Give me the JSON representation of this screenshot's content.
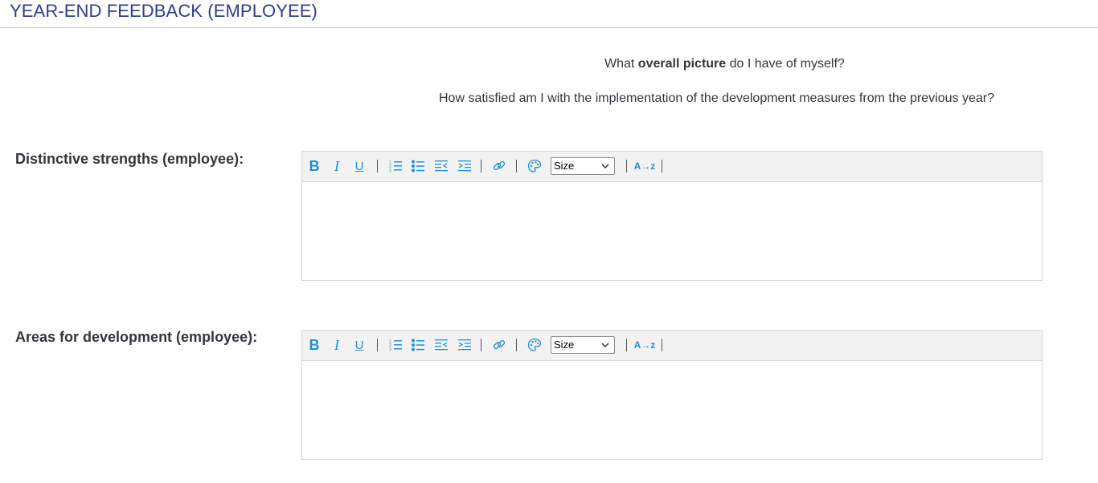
{
  "header": {
    "title": "YEAR-END FEEDBACK (EMPLOYEE)"
  },
  "intro": {
    "line1_pre": "What ",
    "line1_bold": "overall picture",
    "line1_post": " do I have of myself?",
    "line2": "How satisfied am I with the implementation of the development measures from the previous year?"
  },
  "fields": [
    {
      "label": "Distinctive strengths (employee):",
      "value": ""
    },
    {
      "label": "Areas for development (employee):",
      "value": ""
    }
  ],
  "toolbar": {
    "bold": "B",
    "italic": "I",
    "underline": "U",
    "size_select": "Size",
    "format_icon": "A→z"
  },
  "colors": {
    "title": "#2e3e8a",
    "toolbar_icon": "#1f8fd6",
    "toolbar_bg": "#f2f2f2",
    "border": "#d6d6d6"
  }
}
